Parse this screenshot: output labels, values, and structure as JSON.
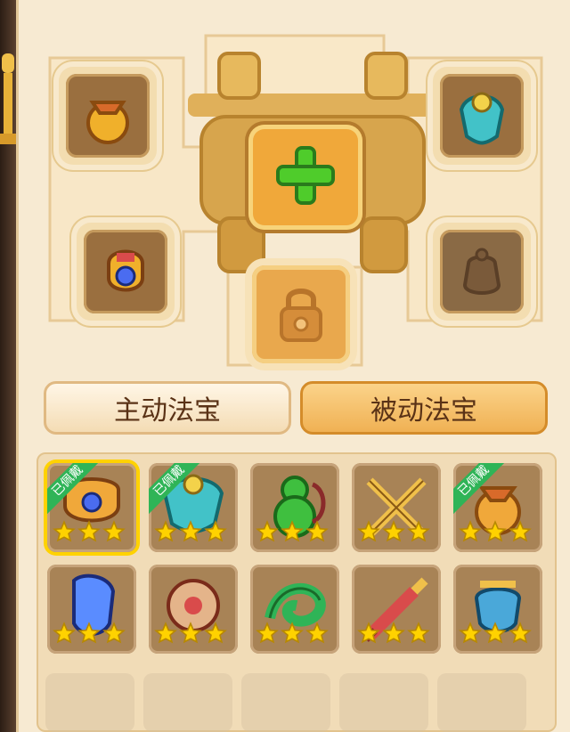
{
  "tabs": {
    "active": "主动法宝",
    "passive": "被动法宝"
  },
  "badges": {
    "equipped": "已佩戴"
  },
  "icons": {
    "add": "plus-icon",
    "lock": "lock-icon"
  },
  "slots": [
    {
      "name": "golden-bag-icon"
    },
    {
      "name": "jade-cloud-cloak-icon"
    },
    {
      "name": "armor-helmet-icon"
    },
    {
      "name": "locked-vessel-icon"
    }
  ],
  "grid": {
    "rows": [
      [
        {
          "name": "armor-helmet-icon",
          "stars": 3,
          "equipped": true,
          "selected": true
        },
        {
          "name": "jade-cloud-cloak-icon",
          "stars": 3,
          "equipped": true,
          "selected": false
        },
        {
          "name": "gourd-icon",
          "stars": 3,
          "equipped": false,
          "selected": false
        },
        {
          "name": "crossed-swords-icon",
          "stars": 3,
          "equipped": false,
          "selected": false
        },
        {
          "name": "golden-bag-icon",
          "stars": 3,
          "equipped": true,
          "selected": false
        }
      ],
      [
        {
          "name": "blue-gem-icon",
          "stars": 3,
          "equipped": false,
          "selected": false
        },
        {
          "name": "red-drum-icon",
          "stars": 3,
          "equipped": false,
          "selected": false
        },
        {
          "name": "jade-dragon-icon",
          "stars": 3,
          "equipped": false,
          "selected": false
        },
        {
          "name": "red-sword-icon",
          "stars": 3,
          "equipped": false,
          "selected": false
        },
        {
          "name": "blue-incense-burner-icon",
          "stars": 3,
          "equipped": false,
          "selected": false
        }
      ]
    ]
  },
  "colors": {
    "panel_bg": "#f7ead2",
    "gold": "#f0a83a",
    "green": "#2fb457",
    "star": "#ffd200"
  }
}
